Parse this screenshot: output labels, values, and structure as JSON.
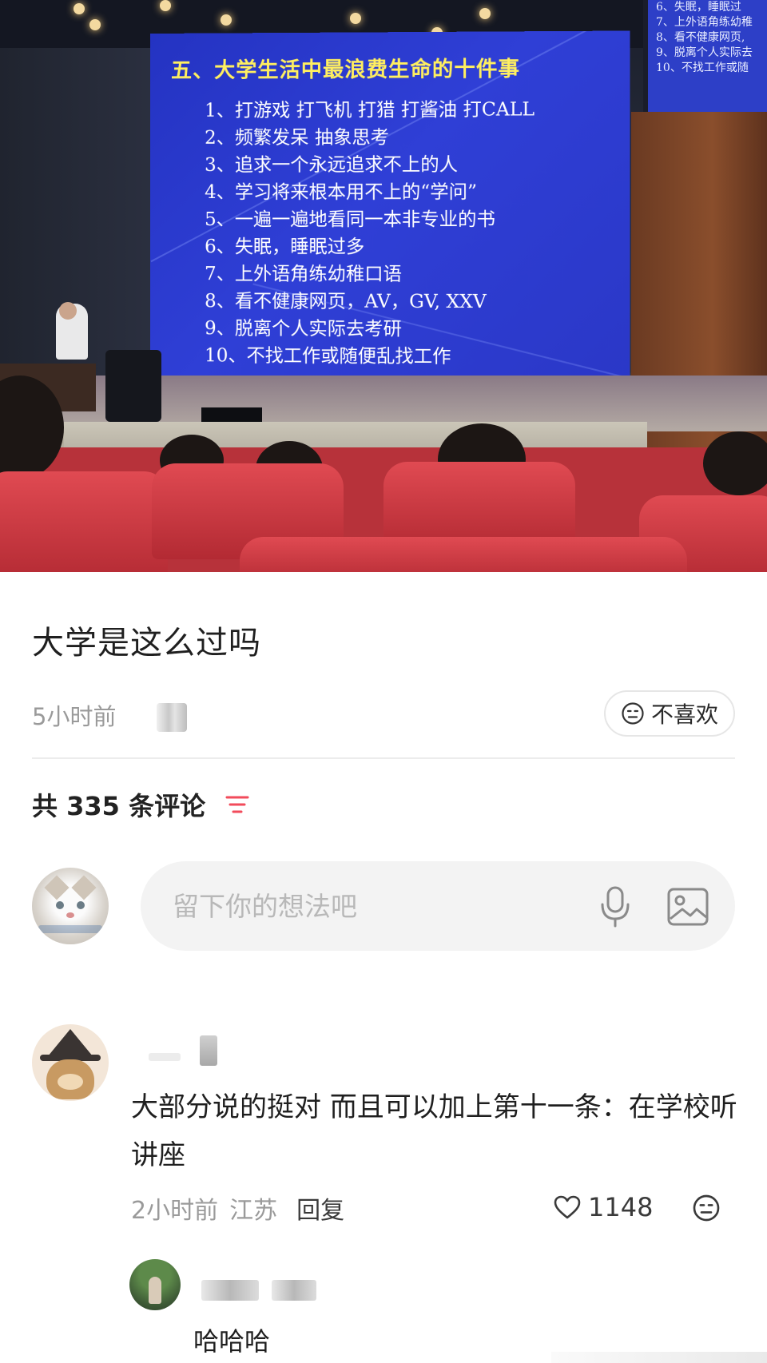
{
  "photo": {
    "slide_title": "五、大学生活中最浪费生命的十件事",
    "slide_items": [
      "1、打游戏  打飞机  打猎  打酱油  打CALL",
      "2、频繁发呆  抽象思考",
      "3、追求一个永远追求不上的人",
      "4、学习将来根本用不上的“学问”",
      "5、一遍一遍地看同一本非专业的书",
      "6、失眠，睡眠过多",
      "7、上外语角练幼稚口语",
      "8、看不健康网页，AV，GV, XXV",
      "9、脱离个人实际去考研",
      "10、不找工作或随便乱找工作"
    ],
    "side_screen_items": [
      "6、失眠，睡眠过",
      "7、上外语角练幼稚",
      "8、看不健康网页,",
      "9、脱离个人实际去",
      "10、不找工作或随"
    ]
  },
  "post": {
    "title": "大学是这么过吗",
    "time": "5小时前",
    "dislike_label": "不喜欢"
  },
  "comments_header": {
    "count_text": "共 335 条评论"
  },
  "composer": {
    "placeholder": "留下你的想法吧"
  },
  "comments": [
    {
      "text": "大部分说的挺对 而且可以加上第十一条：在学校听讲座",
      "time": "2小时前",
      "location": "江苏",
      "reply_label": "回复",
      "likes": "1148",
      "replies": [
        {
          "text": "哈哈哈"
        }
      ]
    }
  ],
  "colors": {
    "accent_red": "#f24b5b",
    "slide_blue": "#2f3fd6",
    "slide_title_yellow": "#ffef60"
  }
}
